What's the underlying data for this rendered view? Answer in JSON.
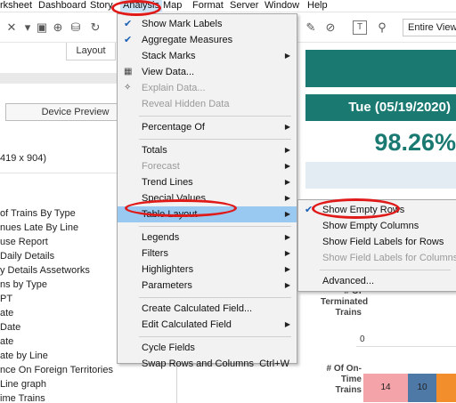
{
  "menubar": {
    "items": [
      "rksheet",
      "Dashboard",
      "Story",
      "Analysis",
      "Map",
      "Format",
      "Server",
      "Window",
      "Help"
    ]
  },
  "toolbar": {
    "view_select": "Entire View"
  },
  "left_panel": {
    "layout_tab": "Layout",
    "device_preview": "Device Preview",
    "size_text": "419 x 904)",
    "sheets": [
      "of Trains By Type",
      "nues Late By Line",
      "use Report",
      "Daily Details",
      "y Details Assetworks",
      "ns by Type",
      "PT",
      "ate",
      "Date",
      "ate",
      "ate  by Line",
      "nce On Foreign Territories",
      "Line graph",
      "ime Trains"
    ]
  },
  "dashboard": {
    "date_banner": "Tue (05/19/2020)",
    "percent": "98.26%",
    "terminated_label": "# Of Terminated Trains",
    "terminated_value": "0",
    "ontime_label": "# Of On-Time Trains",
    "bars": [
      {
        "value": "14",
        "color": "#f4a3a8"
      },
      {
        "value": "10",
        "color": "#4e79a7"
      },
      {
        "value": "",
        "color": "#f28e2b"
      }
    ],
    "colors": {
      "teal": "#1a7a72",
      "light_blue": "#e4ecf3"
    }
  },
  "analysis_menu": {
    "items": [
      {
        "label": "Show Mark Labels",
        "check": true
      },
      {
        "label": "Aggregate Measures",
        "check": true
      },
      {
        "label": "Stack Marks",
        "submenu": true
      },
      {
        "label": "View Data...",
        "icon": "grid-icon"
      },
      {
        "label": "Explain Data...",
        "icon": "bulb-icon",
        "disabled": true
      },
      {
        "label": "Reveal Hidden Data",
        "disabled": true
      },
      {
        "separator": true
      },
      {
        "label": "Percentage Of",
        "submenu": true
      },
      {
        "separator": true
      },
      {
        "label": "Totals",
        "submenu": true
      },
      {
        "label": "Forecast",
        "submenu": true,
        "disabled": true
      },
      {
        "label": "Trend Lines",
        "submenu": true
      },
      {
        "label": "Special Values",
        "submenu": true
      },
      {
        "label": "Table Layout",
        "submenu": true,
        "highlighted": true
      },
      {
        "separator": true
      },
      {
        "label": "Legends",
        "submenu": true
      },
      {
        "label": "Filters",
        "submenu": true
      },
      {
        "label": "Highlighters",
        "submenu": true
      },
      {
        "label": "Parameters",
        "submenu": true
      },
      {
        "separator": true
      },
      {
        "label": "Create Calculated Field..."
      },
      {
        "label": "Edit Calculated Field",
        "submenu": true
      },
      {
        "separator": true
      },
      {
        "label": "Cycle Fields"
      },
      {
        "label": "Swap Rows and Columns",
        "shortcut": "Ctrl+W"
      }
    ]
  },
  "table_layout_submenu": {
    "items": [
      {
        "label": "Show Empty Rows",
        "check": true
      },
      {
        "label": "Show Empty Columns"
      },
      {
        "label": "Show Field Labels for Rows"
      },
      {
        "label": "Show Field Labels for Columns",
        "disabled": true
      },
      {
        "separator": true
      },
      {
        "label": "Advanced..."
      }
    ]
  }
}
